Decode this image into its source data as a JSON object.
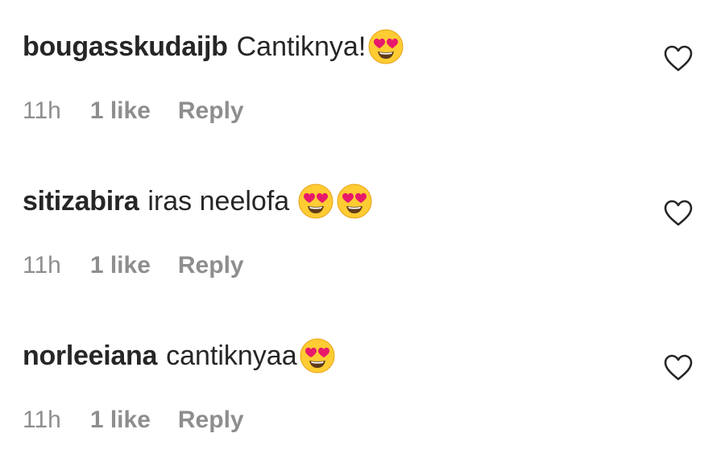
{
  "comments": [
    {
      "username": "bougasskudaijb",
      "text": "Cantiknya!",
      "emojis": [
        "smiling-face-with-heart-eyes"
      ],
      "time": "11h",
      "likes": "1 like",
      "reply_label": "Reply",
      "like_icon": "heart-outline-icon"
    },
    {
      "username": "sitizabira",
      "text": "iras neelofa ",
      "emojis": [
        "smiling-face-with-heart-eyes",
        "smiling-face-with-heart-eyes"
      ],
      "time": "11h",
      "likes": "1 like",
      "reply_label": "Reply",
      "like_icon": "heart-outline-icon"
    },
    {
      "username": "norleeiana",
      "text": "cantiknyaa",
      "emojis": [
        "smiling-face-with-heart-eyes"
      ],
      "time": "11h",
      "likes": "1 like",
      "reply_label": "Reply",
      "like_icon": "heart-outline-icon"
    }
  ],
  "colors": {
    "text_primary": "#262626",
    "text_secondary": "#8e8e8e",
    "background": "#ffffff"
  }
}
